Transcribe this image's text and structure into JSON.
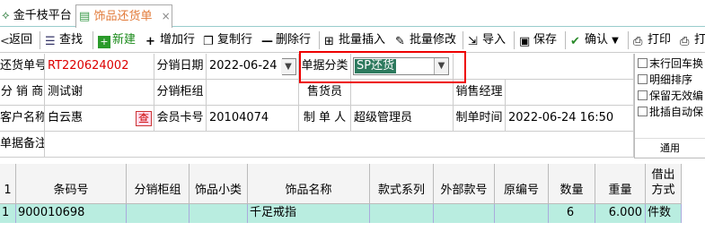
{
  "tabs": {
    "home": "金千枝平台",
    "active": "饰品还货单",
    "close": "×"
  },
  "toolbar": {
    "back": "返回",
    "search": "查找",
    "new": "新建",
    "add_row": "增加行",
    "copy_row": "复制行",
    "delete_row": "删除行",
    "batch_insert": "批量插入",
    "batch_edit": "批量修改",
    "import": "导入",
    "save": "保存",
    "confirm": "确认",
    "print": "打印",
    "print2": "打"
  },
  "form": {
    "doc_no_label": "还货单号",
    "doc_no": "RT220624002",
    "date_label": "分销日期",
    "date": "2022-06-24",
    "category_label": "单据分类",
    "category": "SP还货",
    "dist_label": "分 销 商",
    "dist": "测试谢",
    "counter_label": "分销柜组",
    "counter": "",
    "sales_label": "售货员",
    "sales": "",
    "manager_label": "销售经理",
    "manager": "",
    "customer_label": "客户名称",
    "customer": "白云惠",
    "query": "查",
    "card_label": "会员卡号",
    "card": "20104074",
    "maker_label": "制 单 人",
    "maker": "超级管理员",
    "time_label": "制单时间",
    "time": "2022-06-24 16:50",
    "remark_label": "单据备注",
    "remark": ""
  },
  "options": {
    "opt1": "末行回车换",
    "opt2": "明细排序",
    "opt3": "保留无效编",
    "opt4": "批插自动保",
    "footer": "通用"
  },
  "grid": {
    "headers": [
      "1",
      "条码号",
      "分销柜组",
      "饰品小类",
      "饰品名称",
      "款式系列",
      "外部款号",
      "原编号",
      "数量",
      "重量",
      "借出方式"
    ],
    "rows": [
      [
        "1",
        "900010698",
        "",
        "",
        "千足戒指",
        "",
        "",
        "",
        "6",
        "6.000",
        "件数"
      ]
    ]
  }
}
